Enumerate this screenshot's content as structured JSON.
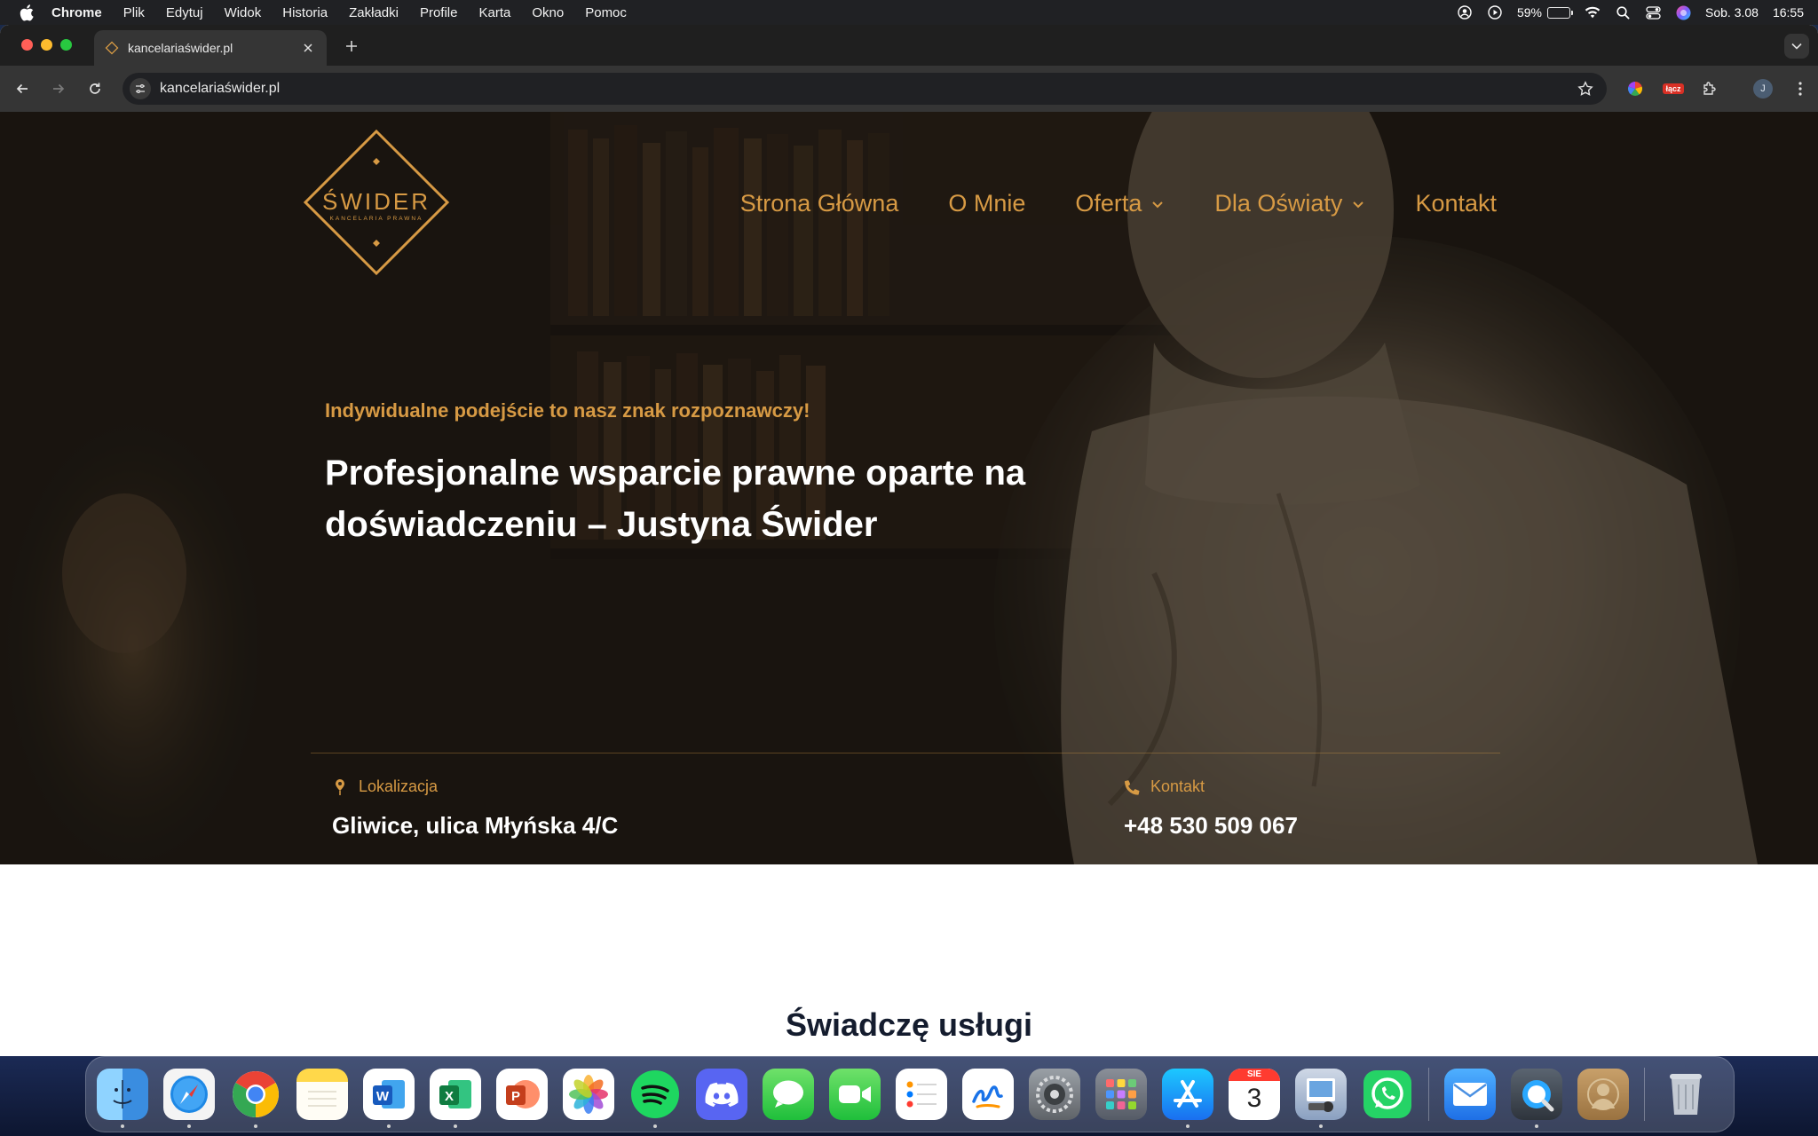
{
  "menubar": {
    "app_name": "Chrome",
    "items": [
      "Plik",
      "Edytuj",
      "Widok",
      "Historia",
      "Zakładki",
      "Profile",
      "Karta",
      "Okno",
      "Pomoc"
    ],
    "battery_percent": "59%",
    "battery_level": 0.59,
    "date": "Sob. 3.08",
    "time": "16:55"
  },
  "browser": {
    "tab_title": "kancelariaświder.pl",
    "url": "kancelariaświder.pl",
    "profile_initial": "J",
    "extension_badge": "łącz"
  },
  "site": {
    "logo": {
      "name": "ŚWIDER",
      "tagline": "KANCELARIA PRAWNA"
    },
    "nav": [
      {
        "label": "Strona Główna",
        "dropdown": false
      },
      {
        "label": "O Mnie",
        "dropdown": false
      },
      {
        "label": "Oferta",
        "dropdown": true
      },
      {
        "label": "Dla Oświaty",
        "dropdown": true
      },
      {
        "label": "Kontakt",
        "dropdown": false
      }
    ],
    "hero": {
      "eyebrow": "Indywidualne podejście to nasz znak rozpoznawczy!",
      "headline": "Profesjonalne wsparcie prawne oparte na doświadczeniu – Justyna Świder"
    },
    "location": {
      "label": "Lokalizacja",
      "value": "Gliwice, ulica Młyńska 4/C"
    },
    "contact": {
      "label": "Kontakt",
      "value": "+48 530 509 067"
    },
    "services_title": "Świadczę usługi"
  },
  "dock": {
    "calendar_month": "SIE",
    "calendar_day": "3",
    "apps": [
      "finder-icon",
      "safari-icon",
      "chrome-icon",
      "notes-icon",
      "word-icon",
      "excel-icon",
      "powerpoint-icon",
      "photos-icon",
      "spotify-icon",
      "discord-icon",
      "messages-icon",
      "facetime-icon",
      "reminders-icon",
      "freeform-icon",
      "system-settings-icon",
      "launchpad-icon",
      "app-store-icon",
      "calendar-icon",
      "preview-icon",
      "whatsapp-icon",
      "mail-icon",
      "quicktime-icon",
      "contacts-icon",
      "trash-icon"
    ]
  },
  "colors": {
    "accent_gold": "#d79a44",
    "hero_text": "#ffffff",
    "section_title": "#141c2e"
  }
}
